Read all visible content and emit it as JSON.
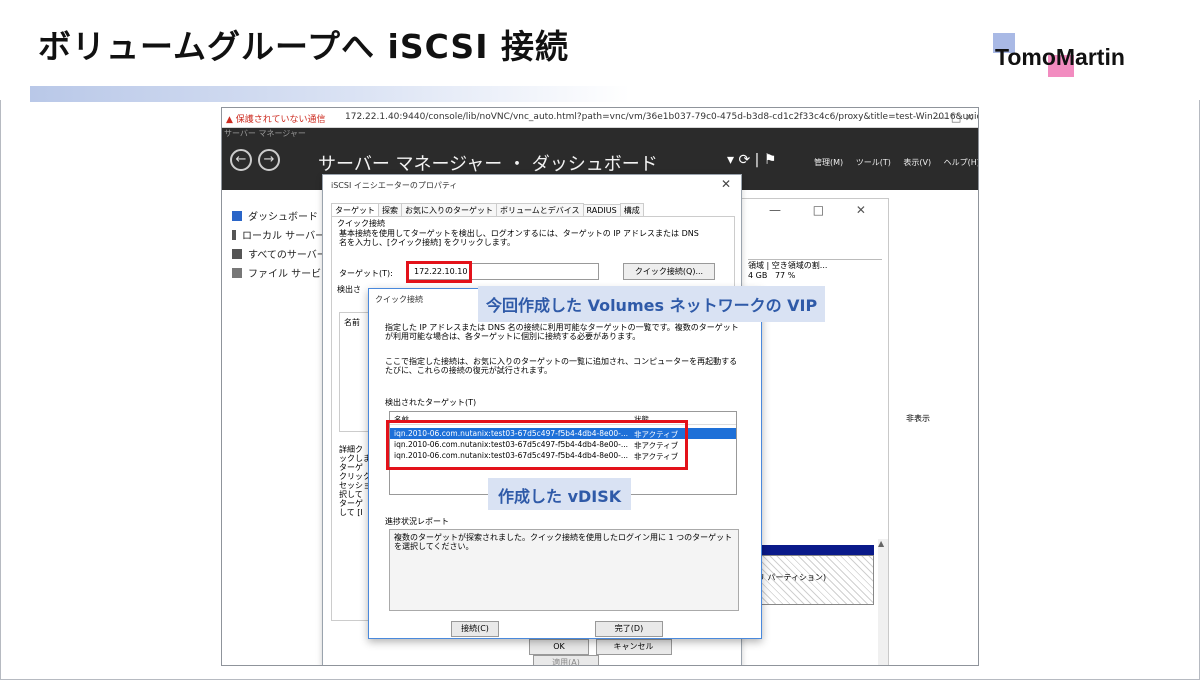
{
  "slide": {
    "title": "ボリュームグループへ iSCSI 接続",
    "logo": {
      "text": "TomoMartin"
    }
  },
  "browser": {
    "warning": "▲ 保護されていない通信",
    "url": "172.22.1.40:9440/console/lib/noVNC/vnc_auto.html?path=vnc/vm/36e1b037-79c0-475d-b3d8-cd1c2f33c4c6/proxy&title=test-Win2016&uuid=36e...",
    "controls": "—  □  ✕"
  },
  "server_manager": {
    "subtitle": "サーバー マネージャー",
    "breadcrumb": "サーバー マネージャー ・ ダッシュボード",
    "menus": [
      "管理(M)",
      "ツール(T)",
      "表示(V)",
      "ヘルプ(H)"
    ],
    "sidebar": [
      "ダッシュボード",
      "ローカル サーバー",
      "すべてのサーバー",
      "ファイル サービスと"
    ]
  },
  "background_window": {
    "col1": "領域",
    "col2": "空き領域の割...",
    "size": "4 GB",
    "pct": "77 %",
    "hide_label": "非表示",
    "partition_text": "リ パーティション)"
  },
  "iscsi_dialog": {
    "title": "iSCSI イニシエーターのプロパティ",
    "tabs": [
      "ターゲット",
      "探索",
      "お気に入りのターゲット",
      "ボリュームとデバイス",
      "RADIUS",
      "構成"
    ],
    "quick_connect_label": "クイック接続",
    "quick_connect_desc": "基本接続を使用してターゲットを検出し、ログオンするには、ターゲットの IP アドレスまたは DNS 名を入力し、[クイック接続] をクリックします。",
    "target_label": "ターゲット(T):",
    "target_value": "172.22.10.10",
    "quick_connect_button": "クイック接続(Q)...",
    "discovered_label": "検出さ",
    "name_header": "名前",
    "detail_text": "詳細ク\nックしま\nターゲ\nクリック\nセッショ\n択して\nターゲ\nして [I",
    "ok": "OK",
    "cancel": "キャンセル",
    "apply": "適用(A)"
  },
  "quick_connect_dialog": {
    "title": "クイック接続",
    "p1": "指定した IP アドレスまたは DNS 名の接続に利用可能なターゲットの一覧です。複数のターゲットが利用可能な場合は、各ターゲットに個別に接続する必要があります。",
    "p2": "ここで指定した接続は、お気に入りのターゲットの一覧に追加され、コンピューターを再起動するたびに、これらの接続の復元が試行されます。",
    "list_title": "検出されたターゲット(T)",
    "col_name": "名前",
    "col_status": "状態",
    "targets": [
      {
        "name": "iqn.2010-06.com.nutanix:test03-67d5c497-f5b4-4db4-8e00-...",
        "status": "非アクティブ"
      },
      {
        "name": "iqn.2010-06.com.nutanix:test03-67d5c497-f5b4-4db4-8e00-...",
        "status": "非アクティブ"
      },
      {
        "name": "iqn.2010-06.com.nutanix:test03-67d5c497-f5b4-4db4-8e00-...",
        "status": "非アクティブ"
      }
    ],
    "progress_title": "進捗状況レポート",
    "progress_text": "複数のターゲットが探索されました。クイック接続を使用したログイン用に 1 つのターゲットを選択してください。",
    "connect_button": "接続(C)",
    "done_button": "完了(D)"
  },
  "annotations": {
    "vip": "今回作成した Volumes ネットワークの VIP",
    "vdisk": "作成した vDISK"
  }
}
